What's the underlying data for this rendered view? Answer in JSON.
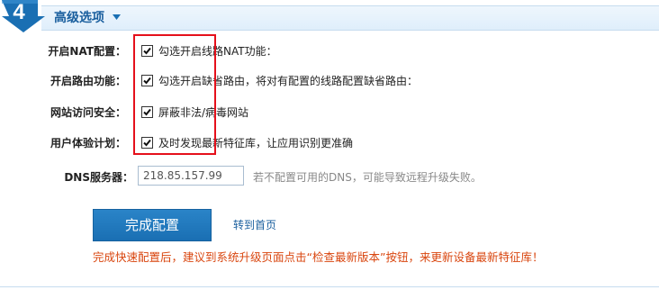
{
  "section": {
    "step_number": "4",
    "title": "高级选项",
    "accent_color": "#1a6fb3",
    "highlight_color": "#e5101b"
  },
  "options": [
    {
      "label": "开启NAT配置：",
      "text": "勾选开启线路NAT功能：",
      "checked": true
    },
    {
      "label": "开启路由功能：",
      "text": "勾选开启缺省路由，将对有配置的线路配置缺省路由：",
      "checked": true
    },
    {
      "label": "网站访问安全：",
      "text": "屏蔽非法/病毒网站",
      "checked": true
    },
    {
      "label": "用户体验计划：",
      "text": "及时发现最新特征库，让应用识别更准确",
      "checked": true
    }
  ],
  "dns": {
    "label": "DNS服务器：",
    "value": "218.85.157.99",
    "hint": "若不配置可用的DNS，可能导致远程升级失败。"
  },
  "actions": {
    "finish_label": "完成配置",
    "home_link": "转到首页"
  },
  "tip": "完成快速配置后，建议到系统升级页面点击“检查最新版本”按钮，来更新设备最新特征库！"
}
